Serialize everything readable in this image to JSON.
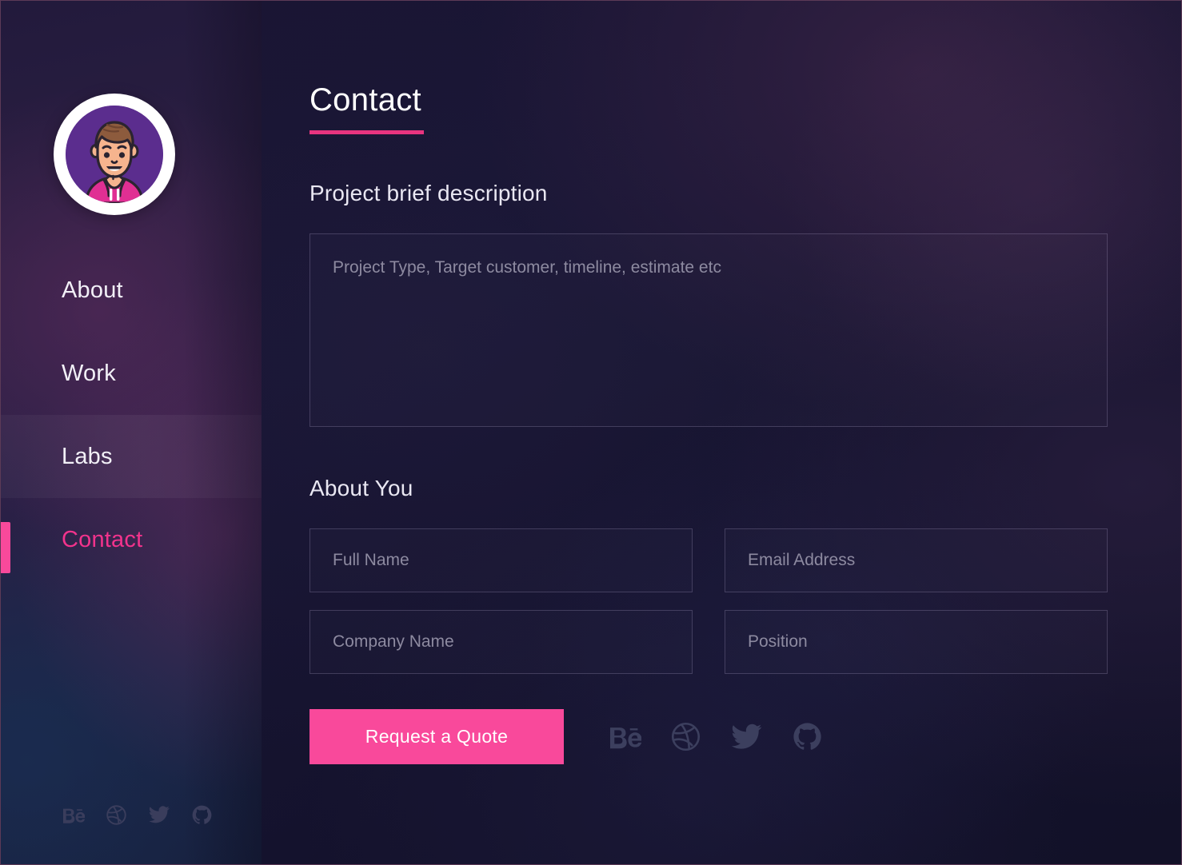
{
  "brand": {
    "accent_pink": "#f9499b",
    "underline_pink": "#e8347f",
    "avatar_bg": "#5b2d8e",
    "avatar_hoodie": "#e02f93",
    "avatar_hair": "#8d5b3d",
    "avatar_skin": "#f6b48e"
  },
  "sidebar": {
    "avatar_alt": "avatar",
    "items": [
      {
        "label": "About",
        "state": "default"
      },
      {
        "label": "Work",
        "state": "default"
      },
      {
        "label": "Labs",
        "state": "hovered"
      },
      {
        "label": "Contact",
        "state": "active"
      }
    ],
    "social": [
      {
        "name": "behance-icon",
        "label": "Behance"
      },
      {
        "name": "dribbble-icon",
        "label": "Dribbble"
      },
      {
        "name": "twitter-icon",
        "label": "Twitter"
      },
      {
        "name": "github-icon",
        "label": "GitHub"
      }
    ]
  },
  "main": {
    "title": "Contact",
    "brief": {
      "label": "Project brief description",
      "value": "",
      "placeholder": "Project Type, Target customer, timeline, estimate etc"
    },
    "about_you": {
      "label": "About You",
      "fields": [
        {
          "name": "full-name-field",
          "placeholder": "Full Name",
          "value": ""
        },
        {
          "name": "email-field",
          "placeholder": "Email Address",
          "value": ""
        },
        {
          "name": "company-name-field",
          "placeholder": "Company Name",
          "value": ""
        },
        {
          "name": "position-field",
          "placeholder": "Position",
          "value": ""
        }
      ]
    },
    "cta_label": "Request a Quote",
    "social": [
      {
        "name": "behance-icon",
        "label": "Behance"
      },
      {
        "name": "dribbble-icon",
        "label": "Dribbble"
      },
      {
        "name": "twitter-icon",
        "label": "Twitter"
      },
      {
        "name": "github-icon",
        "label": "GitHub"
      }
    ]
  }
}
